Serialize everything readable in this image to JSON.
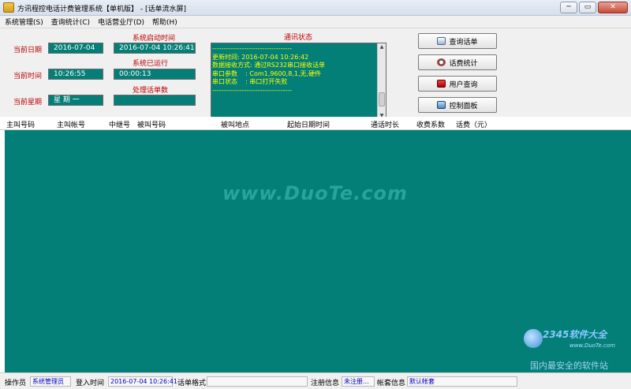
{
  "window": {
    "title": "方讯程控电话计费管理系统【单机版】 - [话单流水屏]",
    "minimize": "─",
    "restore": "▭",
    "close": "✕"
  },
  "menu": [
    "系统管理(S)",
    "查询统计(C)",
    "电话营业厅(D)",
    "帮助(H)"
  ],
  "info": {
    "current_date_label": "当前日期",
    "current_date": "2016-07-04",
    "current_time_label": "当前时间",
    "current_time": "10:26:55",
    "current_weekday_label": "当前星期",
    "current_weekday": "星 期 一",
    "start_time_label": "系统启动时间",
    "start_time": "2016-07-04 10:26:41",
    "uptime_label": "系统已运行",
    "uptime": "00:00:13",
    "processed_label": "处理话单数",
    "processed": ""
  },
  "comm": {
    "title": "通讯状态",
    "lines": [
      "-----------------------------------",
      "更新时间: 2016-07-04 10:26:42",
      "数据接收方式: 通过RS232串口接收话单",
      "串口参数    : Com1,9600,8,1,无,硬件",
      "串口状态    : 串口打开失败",
      "-----------------------------------"
    ]
  },
  "buttons": {
    "query_bill": "查询话单",
    "bill_stats": "话费统计",
    "user_query": "用户查询",
    "control_panel": "控制面板"
  },
  "table": {
    "columns": [
      "主叫号码",
      "主叫帐号",
      "中继号",
      "被叫号码",
      "被叫地点",
      "起始日期时间",
      "通话时长",
      "收费系数",
      "话费（元）"
    ]
  },
  "watermark": "www.DuoTe.com",
  "brand": {
    "name": "2345软件大全",
    "url": "www.DuoTe.com",
    "slogan": "国内最安全的软件站"
  },
  "statusbar": {
    "operator_label": "操作员",
    "operator": "系统管理员",
    "login_label": "登入时间",
    "login_time": "2016-07-04 10:26:41",
    "bill_format_label": "话单格式",
    "bill_format": "",
    "reg_label": "注册信息",
    "reg": "未注册...",
    "account_label": "帐套信息",
    "account": "默认帐套"
  }
}
